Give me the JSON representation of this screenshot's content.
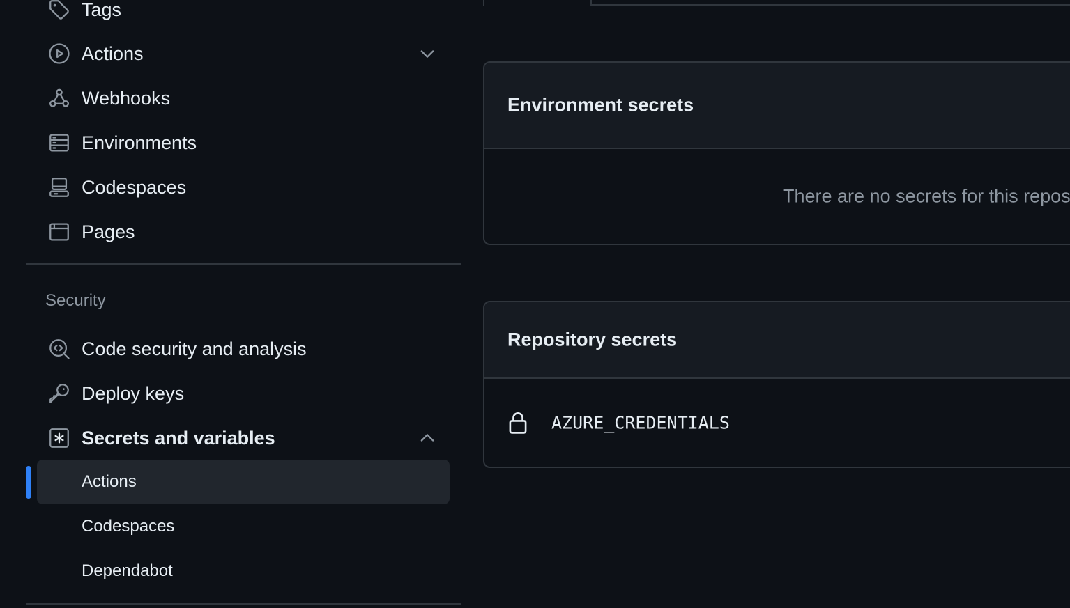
{
  "sidebar": {
    "items": [
      {
        "label": "Tags",
        "icon": "tag-icon"
      },
      {
        "label": "Actions",
        "icon": "play-circle-icon",
        "chevron": "chevron-down-icon"
      },
      {
        "label": "Webhooks",
        "icon": "webhook-icon"
      },
      {
        "label": "Environments",
        "icon": "server-icon"
      },
      {
        "label": "Codespaces",
        "icon": "codespaces-icon"
      },
      {
        "label": "Pages",
        "icon": "browser-icon"
      }
    ],
    "security": {
      "heading": "Security",
      "items": [
        {
          "label": "Code security and analysis",
          "icon": "codescan-icon"
        },
        {
          "label": "Deploy keys",
          "icon": "key-icon"
        },
        {
          "label": "Secrets and variables",
          "icon": "asterisk-icon",
          "chevron": "chevron-up-icon"
        }
      ],
      "subitems": [
        {
          "label": "Actions",
          "active": true
        },
        {
          "label": "Codespaces",
          "active": false
        },
        {
          "label": "Dependabot",
          "active": false
        }
      ]
    }
  },
  "main": {
    "environment_secrets": {
      "title": "Environment secrets",
      "empty_text": "There are no secrets for this repos"
    },
    "repository_secrets": {
      "title": "Repository secrets",
      "secrets": [
        {
          "name": "AZURE_CREDENTIALS",
          "icon": "lock-icon"
        }
      ]
    }
  },
  "colors": {
    "background": "#0d1117",
    "panel_header": "#161b22",
    "border": "#30363d",
    "text": "#e6edf3",
    "muted_text": "#8d96a0",
    "accent": "#2f81f7",
    "active_bg": "#21262d"
  }
}
